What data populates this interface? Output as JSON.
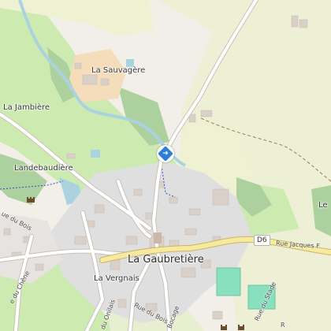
{
  "map": {
    "places": {
      "la_sauvagere": "La Sauvagère",
      "la_jambiere": "La Jambière",
      "landebaudiere": "Landebaudière",
      "la_gaubretiere": "La Gaubretière",
      "la_vergnais": "La Vergnais",
      "le_edge": "Le"
    },
    "roads": {
      "d6_shield": "D6",
      "rue_jacques": "Rue Jacques F",
      "rue_du_bois_left": "ue du Bois",
      "rue_du_chene": "e du Chêne",
      "rue_du_onilais": "e du Onilais",
      "rue_du_bois": "Rue du Bois",
      "bocage": "Bocage",
      "rue_du_stade": "Rue du Stade",
      "rue_right": "R"
    },
    "icons": {
      "direction_marker": "directions-icon",
      "castle": "castle-icon",
      "church": "church-icon"
    },
    "colors": {
      "meadow": "#cdebb0",
      "forest": "#add19e",
      "water": "#aad3df",
      "residential": "#e0dfdf",
      "road_yellow": "#f7e99d",
      "road_white": "#ffffff",
      "building": "#d9d0c9",
      "farmyard": "#f5dcba",
      "pitch": "#88e0be",
      "marker": "#2d7fd6"
    }
  }
}
